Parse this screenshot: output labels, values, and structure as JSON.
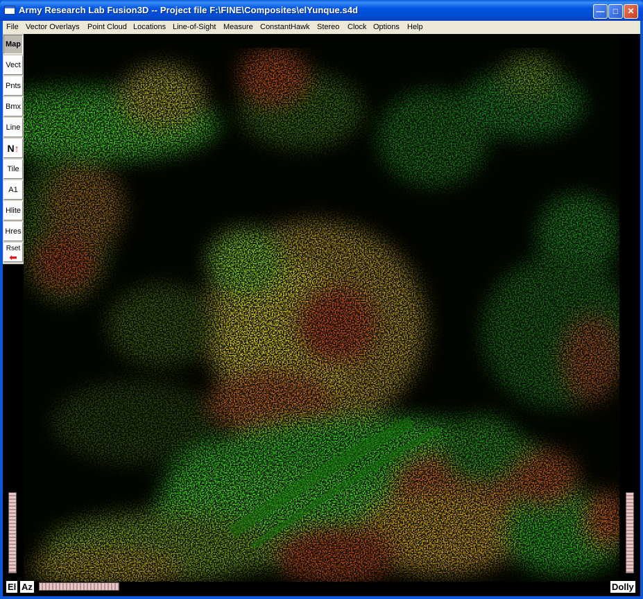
{
  "window": {
    "title": "Army Research Lab Fusion3D  -- Project file F:\\FINE\\Composites\\elYunque.s4d",
    "minimize_glyph": "—",
    "maximize_glyph": "□",
    "close_glyph": "✕"
  },
  "menu": {
    "items": [
      "File",
      "Vector Overlays",
      "Point Cloud",
      "Locations",
      "Line-of-Sight",
      "Measure",
      "ConstantHawk",
      "Stereo",
      "Clock",
      "Options",
      "Help"
    ]
  },
  "toolbar": {
    "buttons": [
      "Map",
      "Vect",
      "Pnts",
      "Bmx",
      "Line",
      "N",
      "Tile",
      "A1",
      "Hlite",
      "Hres",
      "Rset"
    ],
    "north_arrow": "↑",
    "reset_arrow": "⬅"
  },
  "bottom": {
    "el_label": "El",
    "az_label": "Az",
    "dolly_label": "Dolly"
  },
  "colors": {
    "accent": "#0054e3",
    "arrow_red": "#e0141e",
    "slider_pink": "#e9c7c7"
  }
}
